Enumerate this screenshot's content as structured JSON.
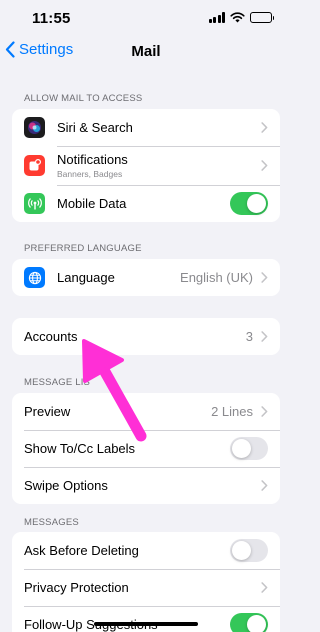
{
  "status_bar": {
    "time": "11:55"
  },
  "nav": {
    "back_label": "Settings",
    "title": "Mail"
  },
  "sections": {
    "allow_access": {
      "header": "ALLOW MAIL TO ACCESS",
      "siri": {
        "label": "Siri & Search",
        "icon": "siri-icon"
      },
      "notifications": {
        "label": "Notifications",
        "subtitle": "Banners, Badges",
        "icon": "notifications-icon"
      },
      "mobile_data": {
        "label": "Mobile Data",
        "icon": "antenna-icon",
        "enabled": true
      }
    },
    "preferred_language": {
      "header": "PREFERRED LANGUAGE",
      "language": {
        "label": "Language",
        "value": "English (UK)",
        "icon": "globe-icon"
      }
    },
    "accounts": {
      "label": "Accounts",
      "value": "3"
    },
    "message_list": {
      "header": "MESSAGE LIS",
      "preview": {
        "label": "Preview",
        "value": "2 Lines"
      },
      "show_tocc": {
        "label": "Show To/Cc Labels",
        "enabled": false
      },
      "swipe_options": {
        "label": "Swipe Options"
      }
    },
    "messages": {
      "header": "MESSAGES",
      "ask_before_deleting": {
        "label": "Ask Before Deleting",
        "enabled": false
      },
      "privacy_protection": {
        "label": "Privacy Protection"
      },
      "follow_up": {
        "label": "Follow-Up Suggestions",
        "enabled": true
      }
    }
  },
  "colors": {
    "accent": "#007aff",
    "toggle_on": "#34c759",
    "annotation": "#ff2fd6",
    "siri_icon_bg": "#1c1c1e",
    "notifications_icon_bg": "#ff3b30",
    "mobile_data_icon_bg": "#34c759",
    "language_icon_bg": "#007aff"
  }
}
